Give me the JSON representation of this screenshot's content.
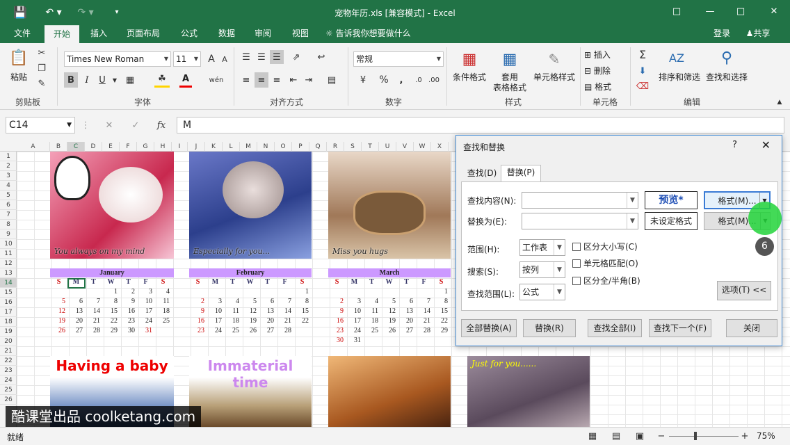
{
  "window": {
    "title": "宠物年历.xls  [兼容模式] - Excel"
  },
  "tabs": [
    "文件",
    "开始",
    "插入",
    "页面布局",
    "公式",
    "数据",
    "审阅",
    "视图"
  ],
  "tell_me": "告诉我你想要做什么",
  "account": {
    "login": "登录",
    "share": "共享"
  },
  "ribbon": {
    "clipboard": {
      "paste": "粘贴",
      "label": "剪贴板"
    },
    "font": {
      "name": "Times New Roman",
      "size": "11",
      "label": "字体",
      "bold": "B",
      "italic": "I",
      "underline": "U",
      "grow": "A",
      "shrink": "A"
    },
    "align": {
      "label": "对齐方式"
    },
    "number": {
      "format": "常规",
      "label": "数字",
      "percent": "%"
    },
    "styles": {
      "cond": "条件格式",
      "table1": "套用",
      "table2": "表格格式",
      "cell": "单元格样式",
      "label": "样式"
    },
    "cells": {
      "insert": "插入",
      "delete": "删除",
      "format": "格式",
      "label": "单元格"
    },
    "edit": {
      "sort": "排序和筛选",
      "find": "查找和选择",
      "label": "编辑"
    }
  },
  "formula_bar": {
    "namebox": "C14",
    "fx": "fx",
    "value": "M"
  },
  "columns": [
    "A",
    "B",
    "C",
    "D",
    "E",
    "F",
    "G",
    "H",
    "I",
    "J",
    "K",
    "L",
    "M",
    "N",
    "O",
    "P",
    "Q",
    "R",
    "S",
    "T",
    "U",
    "V",
    "W",
    "X"
  ],
  "rows": [
    "1",
    "2",
    "3",
    "4",
    "5",
    "6",
    "7",
    "8",
    "9",
    "10",
    "11",
    "12",
    "13",
    "14",
    "15",
    "16",
    "17",
    "18",
    "19",
    "20",
    "21",
    "22",
    "23",
    "24",
    "25",
    "26"
  ],
  "photos": {
    "p1": "You always on my mind",
    "p2": "Especially for you...",
    "p3": "Miss you hugs",
    "p4": "Having a baby",
    "p5": "Immaterial time",
    "p6": "Just for you......"
  },
  "weekdays": [
    "S",
    "M",
    "T",
    "W",
    "T",
    "F",
    "S"
  ],
  "calendar": [
    {
      "month": "January",
      "rows": [
        [
          "",
          "",
          "",
          "",
          "1",
          "2",
          "3",
          "4"
        ],
        [
          "5",
          "6",
          "7",
          "8",
          "9",
          "10",
          "11"
        ],
        [
          "12",
          "13",
          "14",
          "15",
          "16",
          "17",
          "18"
        ],
        [
          "19",
          "20",
          "21",
          "22",
          "23",
          "24",
          "25"
        ],
        [
          "26",
          "27",
          "28",
          "29",
          "30",
          "31",
          ""
        ]
      ]
    },
    {
      "month": "February",
      "rows": [
        [
          "",
          "",
          "",
          "",
          "",
          "",
          "1"
        ],
        [
          "2",
          "3",
          "4",
          "5",
          "6",
          "7",
          "8"
        ],
        [
          "9",
          "10",
          "11",
          "12",
          "13",
          "14",
          "15"
        ],
        [
          "16",
          "17",
          "18",
          "19",
          "20",
          "21",
          "22"
        ],
        [
          "23",
          "24",
          "25",
          "26",
          "27",
          "28",
          ""
        ]
      ]
    },
    {
      "month": "March",
      "rows": [
        [
          "",
          "",
          "",
          "",
          "",
          "",
          "1"
        ],
        [
          "2",
          "3",
          "4",
          "5",
          "6",
          "7",
          "8"
        ],
        [
          "9",
          "10",
          "11",
          "12",
          "13",
          "14",
          "15"
        ],
        [
          "16",
          "17",
          "18",
          "19",
          "20",
          "21",
          "22"
        ],
        [
          "23",
          "24",
          "25",
          "26",
          "27",
          "28",
          "29"
        ],
        [
          "30",
          "31",
          "",
          "",
          "",
          "",
          ""
        ]
      ]
    }
  ],
  "dialog": {
    "title": "查找和替换",
    "help": "?",
    "close": "✕",
    "tab_find": "查找(D)",
    "tab_replace": "替换(P)",
    "find_label": "查找内容(N):",
    "replace_label": "替换为(E):",
    "preview": "预览*",
    "no_format": "未设定格式",
    "format_btn1": "格式(M)...",
    "format_btn2": "格式(M)...",
    "scope_label": "范围(H):",
    "scope_value": "工作表",
    "search_label": "搜索(S):",
    "search_value": "按列",
    "lookin_label": "查找范围(L):",
    "lookin_value": "公式",
    "chk_case": "区分大小写(C)",
    "chk_whole": "单元格匹配(O)",
    "chk_width": "区分全/半角(B)",
    "options": "选项(T) <<",
    "replace_all": "全部替换(A)",
    "replace": "替换(R)",
    "find_all": "查找全部(I)",
    "find_next": "查找下一个(F)",
    "close_btn": "关闭"
  },
  "step_badge": "6",
  "status": {
    "ready": "就绪",
    "zoom": "75%"
  },
  "watermark": "酷课堂出品 coolketang.com"
}
